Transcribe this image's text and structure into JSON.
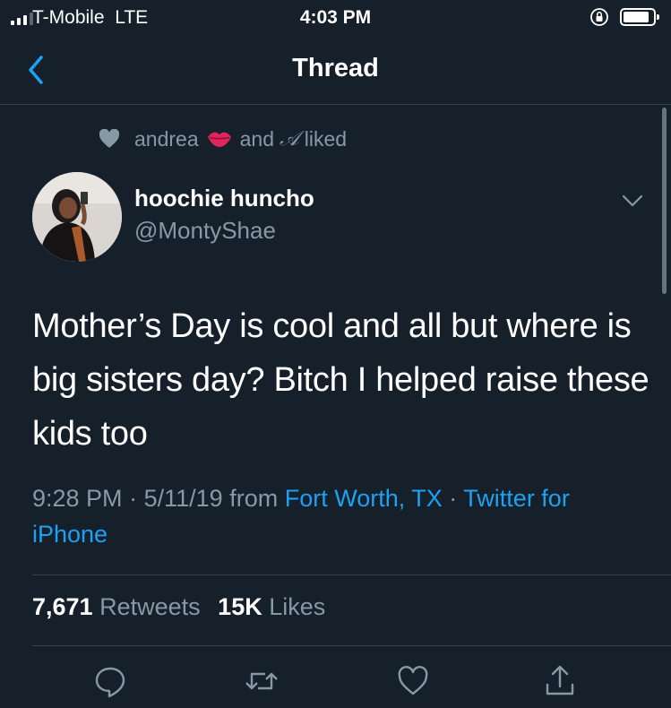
{
  "status_bar": {
    "carrier": "T-Mobile  LTE",
    "time": "4:03 PM"
  },
  "header": {
    "title": "Thread",
    "back_icon": "chevron-left-icon"
  },
  "social_context": {
    "name1": "andrea",
    "and_text": "and",
    "name2": "𝒜",
    "liked_text": "liked",
    "icons": [
      "heart-icon",
      "lips-emoji-icon"
    ]
  },
  "tweet": {
    "display_name": "hoochie huncho",
    "handle": "@MontyShae",
    "text": "Mother’s Day is cool and all but where is big sisters day? Bitch I helped raise these kids too",
    "time": "9:28 PM",
    "date": "5/11/19",
    "from_text": "from",
    "location": "Fort Worth, TX",
    "separator": "·",
    "source": "Twitter for iPhone"
  },
  "stats": {
    "retweets_count": "7,671",
    "retweets_label": "Retweets",
    "likes_count": "15K",
    "likes_label": "Likes"
  },
  "actions": [
    "reply-icon",
    "retweet-icon",
    "like-icon",
    "share-icon"
  ],
  "colors": {
    "background": "#15202b",
    "text": "#ffffff",
    "secondary_text": "#8899a6",
    "link": "#1da1f2",
    "divider": "#38444d"
  }
}
